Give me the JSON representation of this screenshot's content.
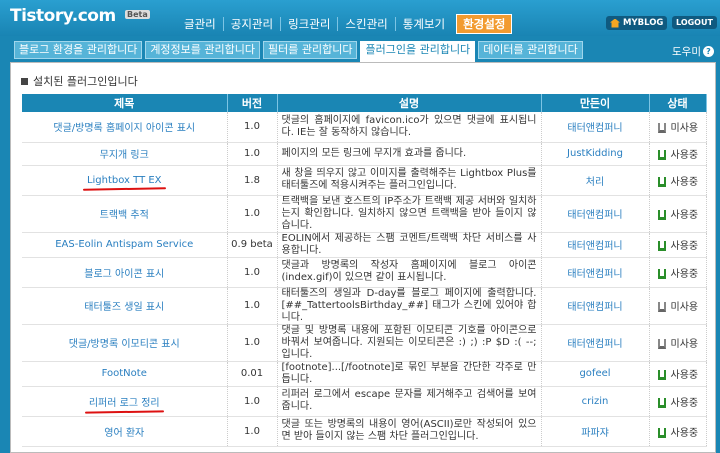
{
  "header": {
    "logo": "Tistory.com",
    "beta": "Beta",
    "nav": [
      "글관리",
      "공지관리",
      "링크관리",
      "스킨관리",
      "통계보기",
      "환경설정"
    ],
    "myblog": "MYBLOG",
    "logout": "LOGOUT"
  },
  "tabs": [
    "블로그 환경을 관리합니다",
    "계정정보를 관리합니다",
    "필터를 관리합니다",
    "플러그인을 관리합니다",
    "데이터를 관리합니다"
  ],
  "help": "도우미",
  "section_title": "설치된 플러그인입니다",
  "columns": [
    "제목",
    "버전",
    "설명",
    "만든이",
    "상태"
  ],
  "rows": [
    {
      "name": "댓글/방명록 홈페이지 아이콘 표시",
      "version": "1.0",
      "desc": "댓글의 홈페이지에 favicon.ico가 있으면 댓글에 표시됩니다. IE는 잘 동작하지 않습니다.",
      "author": "태터앤컴퍼니",
      "status": "미사용"
    },
    {
      "name": "무지개 링크",
      "version": "1.0",
      "desc": "페이지의 모든 링크에 무지개 효과를 줍니다.",
      "author": "JustKidding",
      "status": "사용중"
    },
    {
      "name": "Lightbox TT EX",
      "version": "1.8",
      "desc": "새 창을 띄우지 않고 이미지를 출력해주는 Lightbox Plus를 태터툴즈에 적용시켜주는 플러그인입니다.",
      "author": "처리",
      "status": "사용중"
    },
    {
      "name": "트랙백 추적",
      "version": "1.0",
      "desc": "트랙백을 보낸 호스트의 IP주소가 트랙백 제공 서버와 일치하는지 확인합니다. 일치하지 않으면 트랙백을 받아 들이지 않습니다.",
      "author": "태터앤컴퍼니",
      "status": "사용중"
    },
    {
      "name": "EAS-Eolin Antispam Service",
      "version": "0.9 beta",
      "desc": "EOLIN에서 제공하는 스팸 코멘트/트랙백 차단 서비스를 사용합니다.",
      "author": "태터앤컴퍼니",
      "status": "사용중"
    },
    {
      "name": "블로그 아이콘 표시",
      "version": "1.0",
      "desc": "댓글과 방명록의 작성자 홈페이지에 블로그 아이콘(index.gif)이 있으면 같이 표시됩니다.",
      "author": "태터앤컴퍼니",
      "status": "사용중"
    },
    {
      "name": "태터툴즈 생일 표시",
      "version": "1.0",
      "desc": "태터툴즈의 생일과 D-day를 블로그 페이지에 출력합니다. [##_TattertoolsBirthday_##] 태그가 스킨에 있어야 합니다.",
      "author": "태터앤컴퍼니",
      "status": "미사용"
    },
    {
      "name": "댓글/방명록 이모티콘 표시",
      "version": "1.0",
      "desc": "댓글 및 방명록 내용에 포함된 이모티콘 기호를 아이콘으로 바꿔서 보여줍니다. 지원되는 이모티콘은 :) ;) :P $D :( --; 입니다.",
      "author": "태터앤컴퍼니",
      "status": "미사용"
    },
    {
      "name": "FootNote",
      "version": "0.01",
      "desc": "[footnote]...[/footnote]로 묶인 부분을 간단한 각주로 만듭니다.",
      "author": "gofeel",
      "status": "사용중"
    },
    {
      "name": "리퍼러 로그 정리",
      "version": "1.0",
      "desc": "리퍼러 로그에서 escape 문자를 제거해주고 검색어를 보여줍니다.",
      "author": "crizin",
      "status": "사용중"
    },
    {
      "name": "영어 환자",
      "version": "1.0",
      "desc": "댓글 또는 방명록의 내용이 영어(ASCII)로만 작성되어 있으면 받아 들이지 않는 스팸 차단 플러그인입니다.",
      "author": "파파쟈",
      "status": "사용중"
    }
  ]
}
